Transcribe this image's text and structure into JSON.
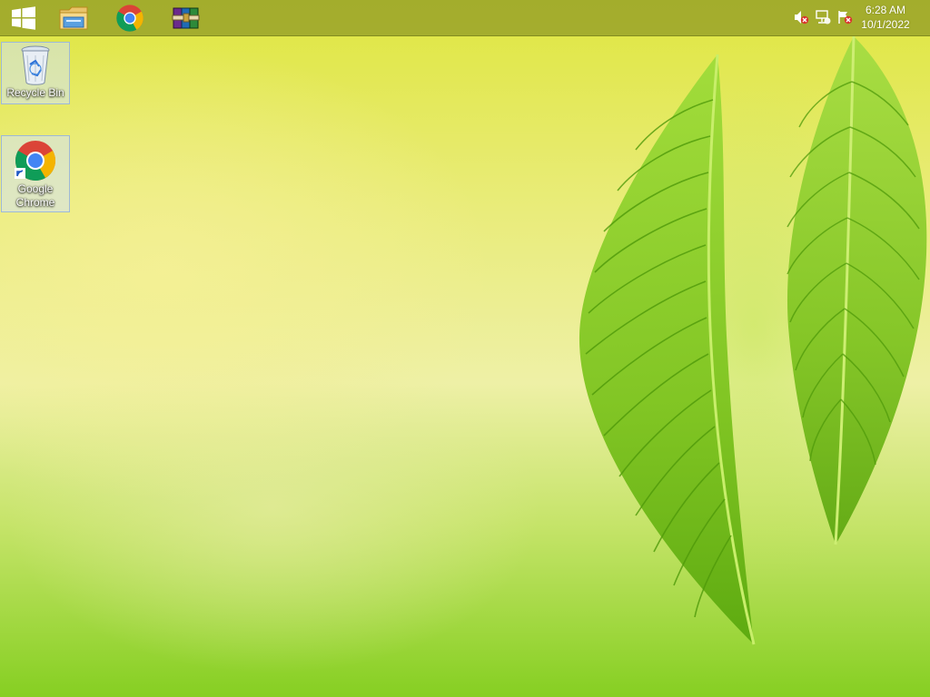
{
  "taskbar": {
    "start_button": {
      "icon": "windows-logo-icon"
    },
    "pinned": [
      {
        "name": "file-explorer",
        "icon": "folder-icon"
      },
      {
        "name": "google-chrome",
        "icon": "chrome-icon"
      },
      {
        "name": "winrar",
        "icon": "winrar-icon"
      }
    ],
    "tray": {
      "icons": [
        "speaker-muted-icon",
        "network-icon",
        "action-center-flag-icon"
      ],
      "time": "6:28 AM",
      "date": "10/1/2022"
    }
  },
  "desktop": {
    "icons": [
      {
        "label": "Recycle Bin",
        "icon": "recycle-bin-icon"
      },
      {
        "label": "Google\nChrome",
        "icon": "chrome-shortcut-icon"
      }
    ]
  },
  "colors": {
    "taskbar": "#96a028",
    "leaf_green": "#7cc31e",
    "chrome_red": "#db4437",
    "chrome_yellow": "#f4b400",
    "chrome_green": "#0f9d58",
    "chrome_blue": "#4285f4"
  }
}
